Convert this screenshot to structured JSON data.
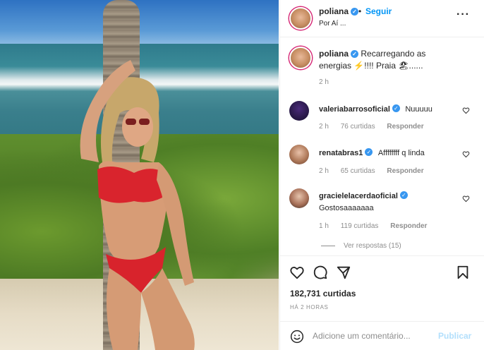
{
  "post": {
    "username": "poliana",
    "follow_label": "Seguir",
    "dot": "•",
    "location": "Por Aí ...",
    "more_icon": "more-horizontal-icon",
    "caption_user": "poliana",
    "caption_text": "Recarregando as energias ⚡!!!! Praia 🏖......",
    "caption_time": "2 h"
  },
  "comments": [
    {
      "user": "valeriabarrosoficial",
      "text": "Nuuuuu",
      "time": "2 h",
      "likes": "76 curtidas",
      "reply": "Responder"
    },
    {
      "user": "renatabras1",
      "text": "Affffffff q linda",
      "time": "2 h",
      "likes": "65 curtidas",
      "reply": "Responder"
    },
    {
      "user": "gracielelacerdaoficial",
      "text": "Gostosaaaaaaa",
      "time": "1 h",
      "likes": "119 curtidas",
      "reply": "Responder"
    }
  ],
  "more_replies": "Ver respostas (15)",
  "actions": {
    "likes": "182,731 curtidas",
    "time_ago": "HÁ 2 HORAS"
  },
  "add_comment": {
    "placeholder": "Adicione um comentário...",
    "publish": "Publicar"
  },
  "colors": {
    "accent": "#0095f6",
    "verified": "#3897f0",
    "muted": "#8e8e8e",
    "publish_disabled": "#b2dffc"
  }
}
